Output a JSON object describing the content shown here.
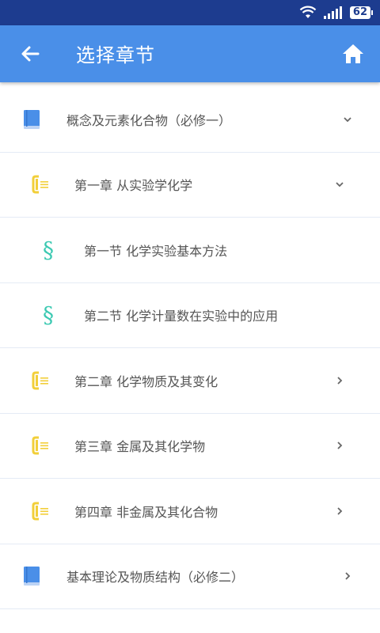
{
  "status_bar": {
    "battery": "62"
  },
  "app_bar": {
    "title": "选择章节",
    "back_icon": "arrow-left-icon",
    "home_icon": "home-icon"
  },
  "colors": {
    "app_bar": "#4a8fe8",
    "status_bar": "#1d3c8f",
    "book_icon": "#4a8fe8",
    "chapter_icon": "#f2cf3a",
    "section_icon": "#3cc9b2"
  },
  "list": {
    "items": [
      {
        "level": 0,
        "label": "概念及元素化合物（必修一）",
        "icon": "book-icon",
        "chevron": "chevron-down-icon"
      },
      {
        "level": 1,
        "label": "第一章 从实验学化学",
        "icon": "chapter-icon",
        "chevron": "chevron-down-icon"
      },
      {
        "level": 2,
        "label": "第一节 化学实验基本方法",
        "icon": "section-icon",
        "glyph": "§"
      },
      {
        "level": 2,
        "label": "第二节 化学计量数在实验中的应用",
        "icon": "section-icon",
        "glyph": "§"
      },
      {
        "level": 1,
        "label": "第二章 化学物质及其变化",
        "icon": "chapter-icon",
        "chevron": "chevron-right-icon"
      },
      {
        "level": 1,
        "label": "第三章 金属及其化学物",
        "icon": "chapter-icon",
        "chevron": "chevron-right-icon"
      },
      {
        "level": 1,
        "label": "第四章 非金属及其化合物",
        "icon": "chapter-icon",
        "chevron": "chevron-right-icon"
      },
      {
        "level": 0,
        "label": "基本理论及物质结构（必修二）",
        "icon": "book-icon",
        "chevron": "chevron-right-icon"
      }
    ]
  }
}
